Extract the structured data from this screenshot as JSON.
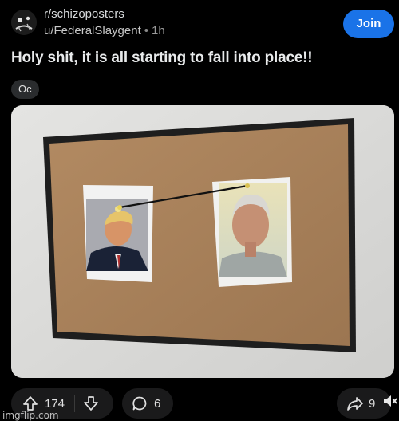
{
  "header": {
    "subreddit": "r/schizoposters",
    "username": "u/FederalSlaygent",
    "separator": "•",
    "time": "1h",
    "join_label": "Join"
  },
  "post": {
    "title": "Holy shit, it is all starting to fall into place!!",
    "flair": "Oc"
  },
  "actions": {
    "upvotes": "174",
    "comments": "6",
    "shares": "9"
  },
  "watermark": "imgflip.com",
  "colors": {
    "background": "#000000",
    "join_button": "#1a73e8",
    "pill": "#1a1a1b",
    "corkboard": "#a9825b",
    "board_frame": "#1f1f1f",
    "wall": "#d9d9d7"
  },
  "icons": {
    "upvote": "arrow-up-icon",
    "downvote": "arrow-down-icon",
    "comment": "comment-bubble-icon",
    "share": "share-arrow-icon",
    "mute": "speaker-muted-icon"
  }
}
